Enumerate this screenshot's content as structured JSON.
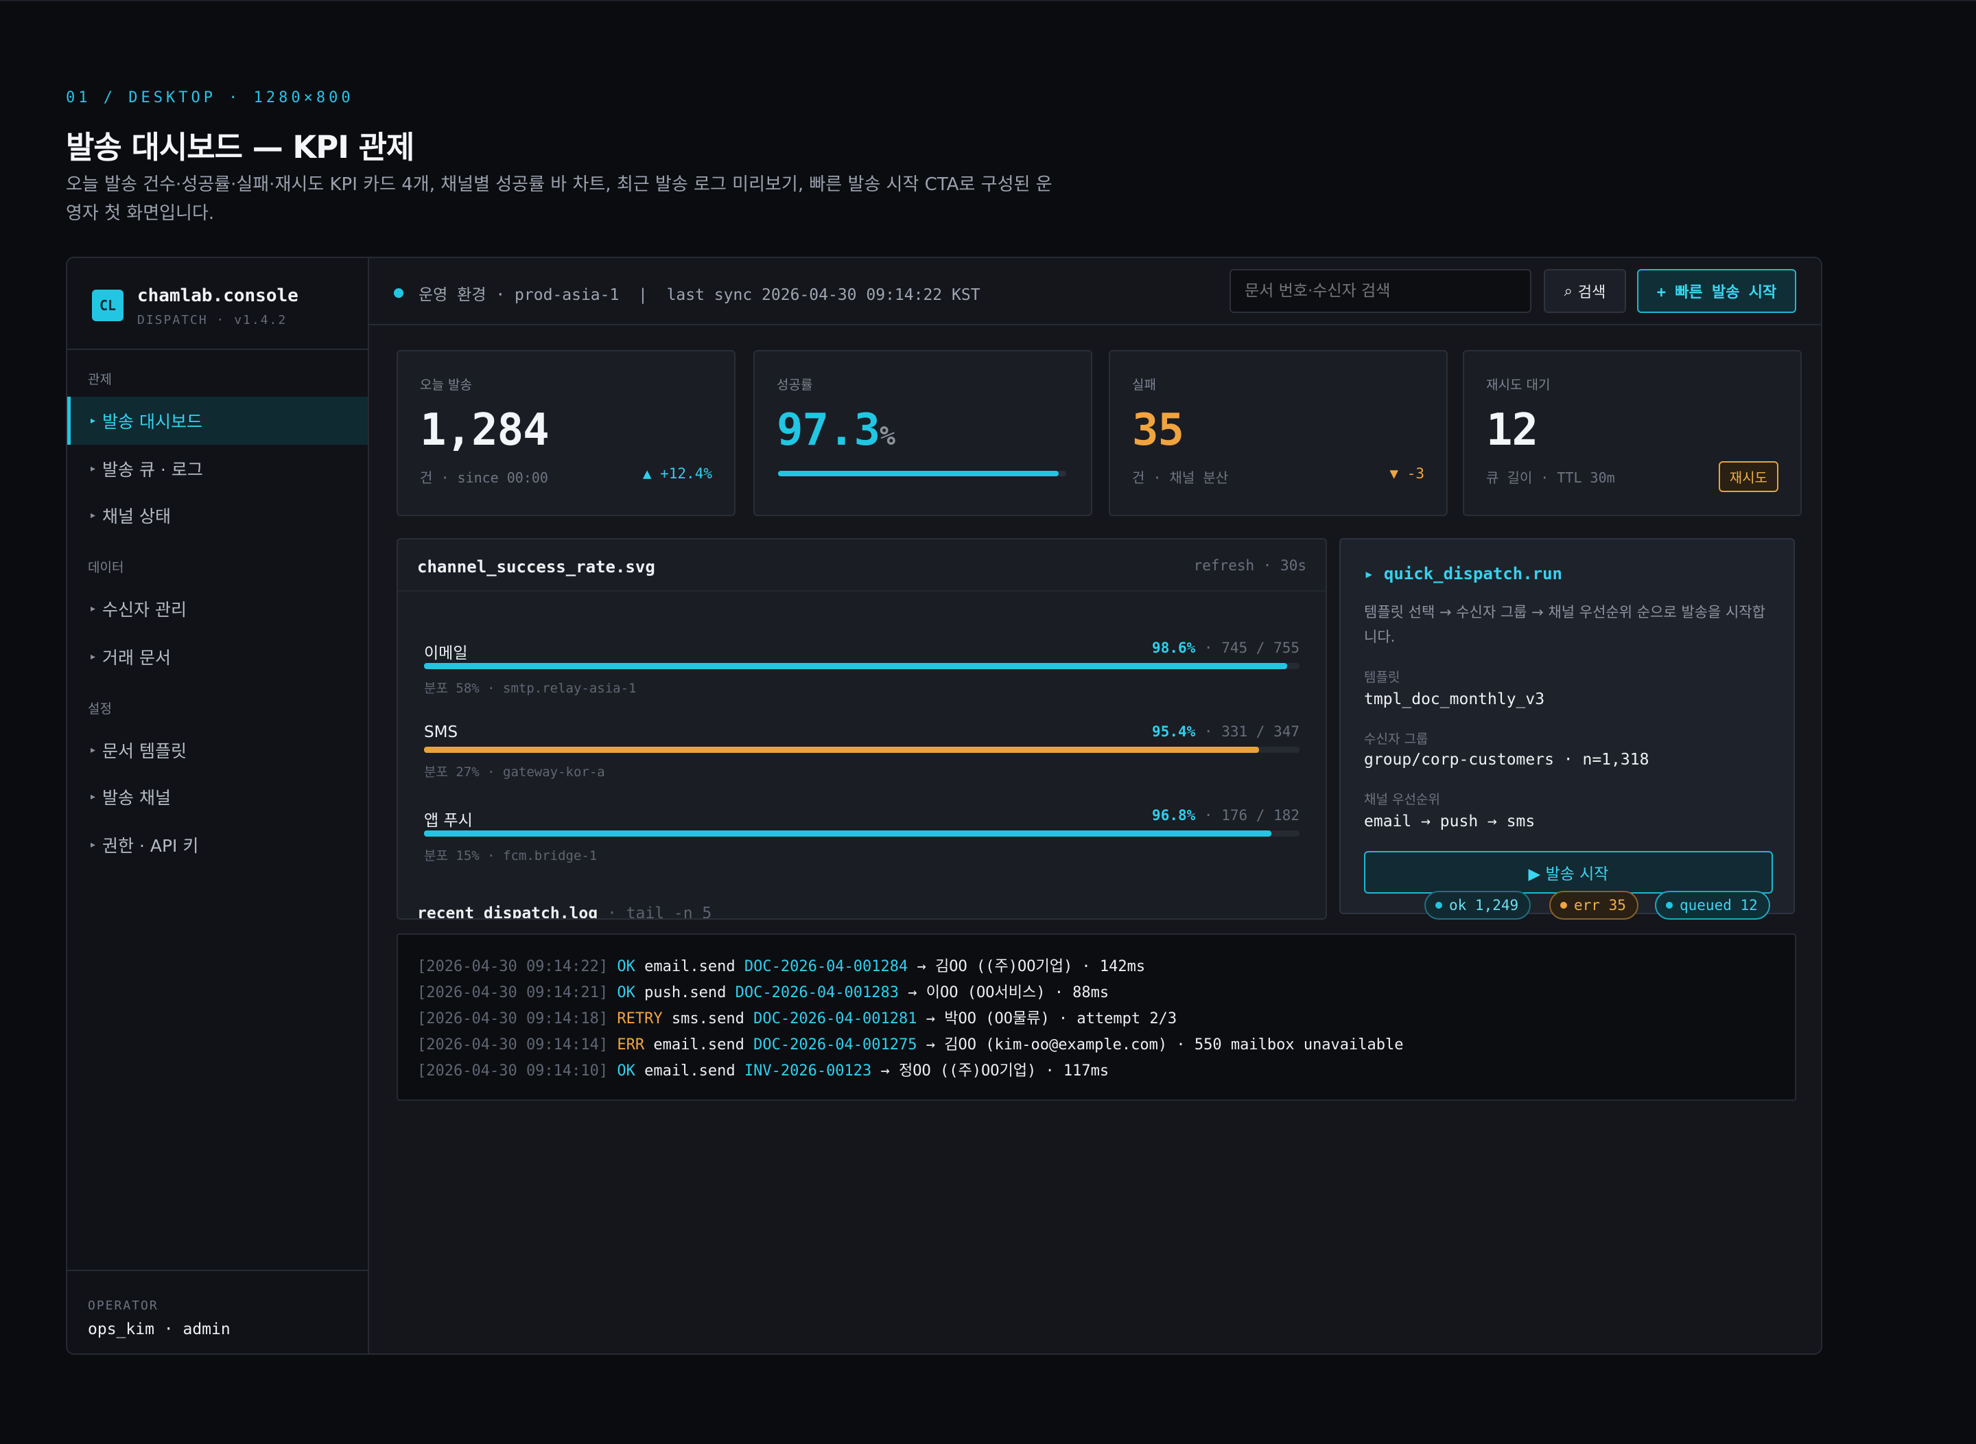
{
  "header": {
    "eyebrow": "01 / DESKTOP · 1280×800",
    "title": "발송 대시보드 — KPI 관제",
    "description": "오늘 발송 건수·성공률·실패·재시도 KPI 카드 4개, 채널별 성공률 바 차트, 최근 발송 로그 미리보기, 빠른 발송 시작 CTA로 구성된 운영자 첫 화면입니다."
  },
  "brand": {
    "logo": "CL",
    "name": "chamlab.console",
    "sub": "DISPATCH · v1.4.2"
  },
  "sidebar": {
    "sections": [
      {
        "label": "관제"
      },
      {
        "label": "데이터"
      },
      {
        "label": "설정"
      }
    ],
    "items": [
      {
        "label": "발송 대시보드",
        "active": true
      },
      {
        "label": "발송 큐 · 로그"
      },
      {
        "label": "채널 상태"
      },
      {
        "label": "수신자 관리"
      },
      {
        "label": "거래 문서"
      },
      {
        "label": "문서 템플릿"
      },
      {
        "label": "발송 채널"
      },
      {
        "label": "권한 · API 키"
      }
    ],
    "caret": "▸"
  },
  "operator": {
    "label": "OPERATOR",
    "value": "ops_kim · admin"
  },
  "topbar": {
    "env": "운영 환경 · prod-asia-1  |  last sync 2026-04-30 09:14:22 KST",
    "search_placeholder": "문서 번호·수신자 검색",
    "search_icon": "⌕",
    "search_label": "검색",
    "cta_label": "+ 빠른 발송 시작"
  },
  "kpis": [
    {
      "label": "오늘 발송",
      "value": "1,284",
      "sub": "건 · since 00:00",
      "delta": "▲ +12.4%"
    },
    {
      "label": "성공률",
      "value": "97.3",
      "unit": "%",
      "progress": 0.973
    },
    {
      "label": "실패",
      "value": "35",
      "sub": "건 · 채널 분산",
      "delta": "▼ -3"
    },
    {
      "label": "재시도 대기",
      "value": "12",
      "sub": "큐 길이 · TTL 30m",
      "badge": "재시도"
    }
  ],
  "colors": {
    "accent": "#22c6e2",
    "warn": "#e7a33a",
    "background": "#0b0c10"
  },
  "chart_panel": {
    "title": "channel_success_rate.svg",
    "refresh": "refresh · 30s"
  },
  "chart_data": {
    "type": "bar",
    "categories": [
      "이메일",
      "SMS",
      "앱 푸시"
    ],
    "values": [
      98.6,
      95.4,
      96.8
    ],
    "value_labels": [
      "98.6%",
      "95.4%",
      "96.8%"
    ],
    "counts": [
      "· 745 / 755",
      "· 331 / 347",
      "· 176 / 182"
    ],
    "meta": [
      "분포 58% · smtp.relay-asia-1",
      "분포 27% · gateway-kor-a",
      "분포 15% · fcm.bridge-1"
    ],
    "colors": [
      "#22c6e2",
      "#e7a33a",
      "#22c6e2"
    ],
    "xlim": [
      0,
      100
    ]
  },
  "quick": {
    "title": "▸ quick_dispatch.run",
    "desc": "템플릿 선택 → 수신자 그룹 → 채널 우선순위 순으로 발송을 시작합니다.",
    "template_label": "템플릿",
    "template_value": "tmpl_doc_monthly_v3",
    "group_label": "수신자 그룹",
    "group_value": "group/corp-customers · n=1,318",
    "priority_label": "채널 우선순위",
    "priority_value": "email → push → sms",
    "send_label": "▶ 발송 시작"
  },
  "pills": [
    {
      "label": "ok 1,249"
    },
    {
      "label": "err 35"
    },
    {
      "label": "queued 12"
    }
  ],
  "log": {
    "title": "recent_dispatch.log",
    "sub": " · tail -n 5",
    "lines": [
      {
        "time": "[2026-04-30 09:14:22]",
        "status": "OK",
        "action": " email.send ",
        "doc": "DOC-2026-04-001284",
        "rest": " → 김OO ((주)OO기업) · 142ms"
      },
      {
        "time": "[2026-04-30 09:14:21]",
        "status": "OK",
        "action": " push.send ",
        "doc": "DOC-2026-04-001283",
        "rest": " → 이OO (OO서비스) · 88ms"
      },
      {
        "time": "[2026-04-30 09:14:18]",
        "status": "RETRY",
        "action": " sms.send ",
        "doc": "DOC-2026-04-001281",
        "rest": " → 박OO (OO물류) · attempt 2/3"
      },
      {
        "time": "[2026-04-30 09:14:14]",
        "status": "ERR",
        "action": " email.send ",
        "doc": "DOC-2026-04-001275",
        "rest": " → 김OO (kim-oo@example.com) · 550 mailbox unavailable"
      },
      {
        "time": "[2026-04-30 09:14:10]",
        "status": "OK",
        "action": " email.send ",
        "doc": "INV-2026-00123",
        "rest": " → 정OO ((주)OO기업) · 117ms"
      }
    ]
  }
}
